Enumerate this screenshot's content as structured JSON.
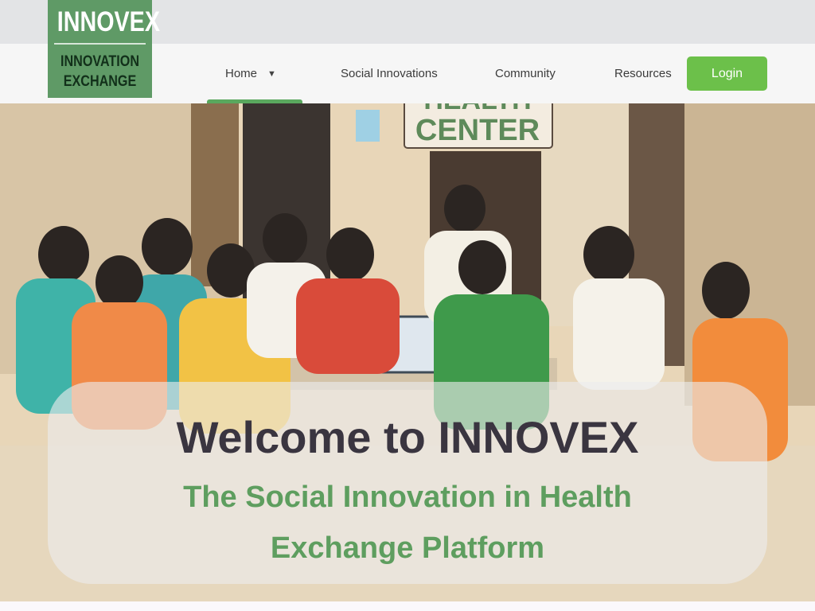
{
  "brand": {
    "name": "INNOVEX",
    "subtitle_line1": "INNOVATION",
    "subtitle_line2": "EXCHANGE",
    "color": "#5f9a66"
  },
  "nav": {
    "items": [
      {
        "label": "Home",
        "active": true,
        "has_dropdown": true
      },
      {
        "label": "Social Innovations"
      },
      {
        "label": "Community"
      },
      {
        "label": "Resources"
      }
    ],
    "login_label": "Login",
    "accent_color": "#6cc04a"
  },
  "hero": {
    "sign_text_top": "HEALTH",
    "sign_text": "CENTER",
    "title": "Welcome to INNOVEX",
    "subtitle": "The Social Innovation in Health Exchange Platform"
  }
}
